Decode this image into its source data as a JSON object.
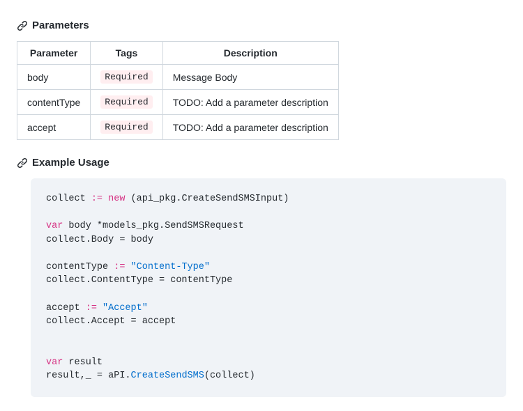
{
  "sections": {
    "parameters_heading": "Parameters",
    "example_heading": "Example Usage"
  },
  "params_table": {
    "headers": {
      "c1": "Parameter",
      "c2": "Tags",
      "c3": "Description"
    },
    "rows": [
      {
        "param": "body",
        "tag": "Required",
        "desc": "Message Body"
      },
      {
        "param": "contentType",
        "tag": "Required",
        "desc": "TODO: Add a parameter description"
      },
      {
        "param": "accept",
        "tag": "Required",
        "desc": "TODO: Add a parameter description"
      }
    ]
  },
  "code": {
    "l1a": "collect ",
    "l1op": ":=",
    "l1b": " ",
    "l1new": "new",
    "l1c": " (api_pkg.CreateSendSMSInput)",
    "l2var": "var",
    "l2": " body *models_pkg.SendSMSRequest",
    "l3": "collect.Body = body",
    "l4a": "contentType ",
    "l4op": ":=",
    "l4b": " ",
    "l4str": "\"Content-Type\"",
    "l5": "collect.ContentType = contentType",
    "l6a": "accept ",
    "l6op": ":=",
    "l6b": " ",
    "l6str": "\"Accept\"",
    "l7": "collect.Accept = accept",
    "l8var": "var",
    "l8": " result",
    "l9a": "result,_ = aPI.",
    "l9fn": "CreateSendSMS",
    "l9b": "(collect)"
  }
}
